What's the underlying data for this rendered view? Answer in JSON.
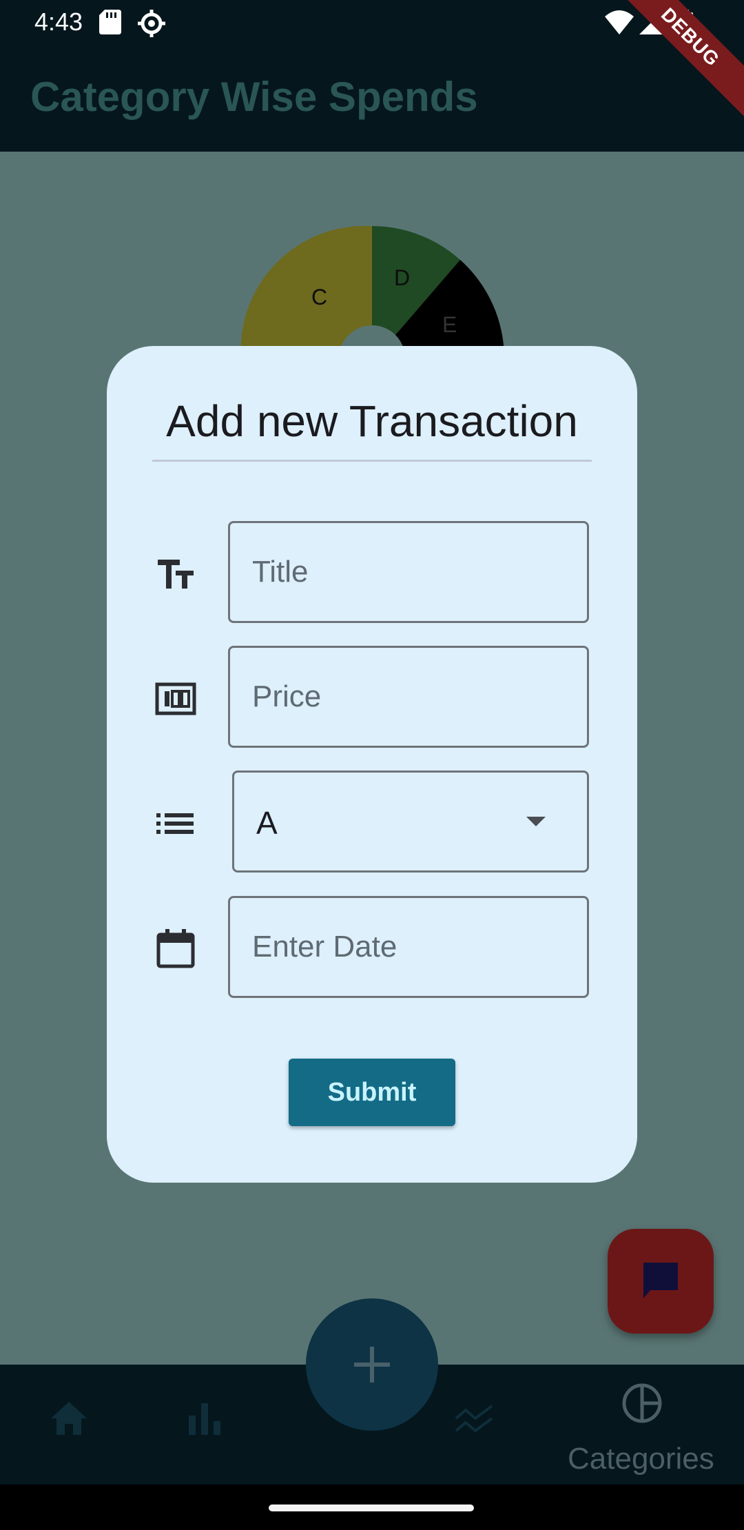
{
  "status_bar": {
    "time": "4:43",
    "icons": [
      "sd-card-icon",
      "settings-icon",
      "wifi-icon",
      "signal-icon",
      "battery-icon"
    ]
  },
  "debug_ribbon": "DEBUG",
  "app_bar": {
    "title": "Category Wise Spends"
  },
  "chart_data": {
    "type": "pie",
    "style": "donut",
    "labels": [
      "C",
      "D",
      "E"
    ],
    "colors": {
      "C": "#6e6a1e",
      "D": "#1f4a23",
      "E": "#000000"
    }
  },
  "dialog": {
    "title": "Add new Transaction",
    "title_field": {
      "placeholder": "Title",
      "icon": "text-fields-icon"
    },
    "price_field": {
      "placeholder": "Price",
      "icon": "money-icon"
    },
    "category_field": {
      "value": "A",
      "icon": "list-icon"
    },
    "date_field": {
      "placeholder": "Enter Date",
      "icon": "calendar-icon"
    },
    "submit_label": "Submit"
  },
  "fab": {
    "add_icon": "plus-icon",
    "chat_icon": "chat-icon"
  },
  "bottom_nav": {
    "items": [
      {
        "icon": "home-icon",
        "label": ""
      },
      {
        "icon": "bar-chart-icon",
        "label": ""
      },
      {
        "icon": "stacked-line-icon",
        "label": ""
      },
      {
        "icon": "pie-chart-icon",
        "label": "Categories"
      }
    ]
  },
  "colors": {
    "scrim_background": "#597573",
    "dialog_background": "#ddf0fc",
    "submit_button": "#146b86",
    "chat_fab": "#6c1717",
    "add_fab": "#0d3345",
    "app_bar": "#05161d"
  }
}
